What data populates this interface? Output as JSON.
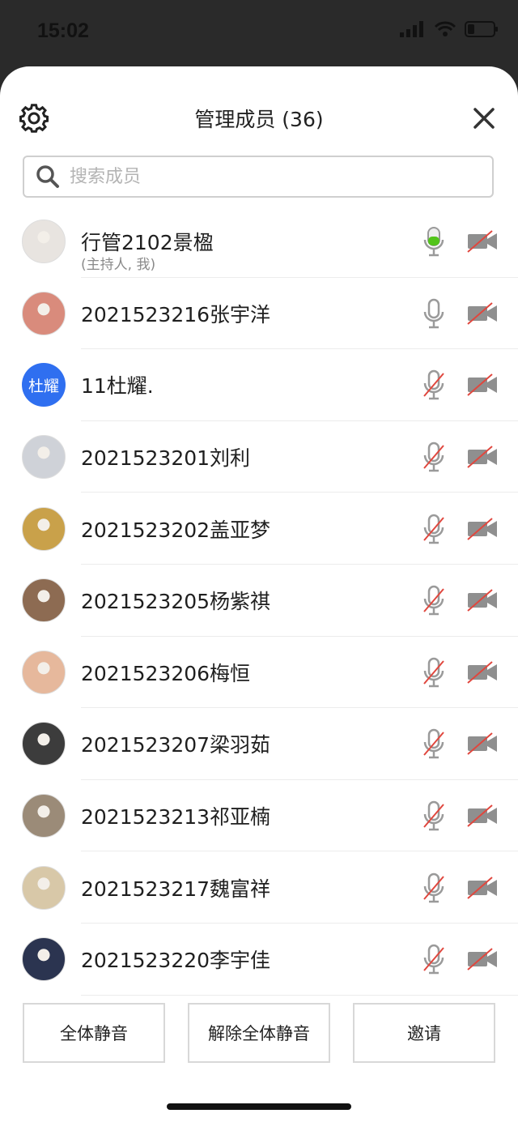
{
  "status_bar": {
    "time": "15:02"
  },
  "header": {
    "title": "管理成员 (36)"
  },
  "search": {
    "placeholder": "搜索成员"
  },
  "members": [
    {
      "name": "行管2102景楹",
      "sub": "(主持人, 我)",
      "mic": "active",
      "avatar": "photo-girl"
    },
    {
      "name": "2021523216张宇洋",
      "sub": "",
      "mic": "on",
      "avatar": "photo-cartoon"
    },
    {
      "name": "11杜耀.",
      "sub": "",
      "mic": "muted",
      "avatar": "text",
      "avatar_text": "杜耀"
    },
    {
      "name": "2021523201刘利",
      "sub": "",
      "mic": "muted",
      "avatar": "photo"
    },
    {
      "name": "2021523202盖亚梦",
      "sub": "",
      "mic": "muted",
      "avatar": "photo"
    },
    {
      "name": "2021523205杨紫祺",
      "sub": "",
      "mic": "muted",
      "avatar": "photo"
    },
    {
      "name": "2021523206梅恒",
      "sub": "",
      "mic": "muted",
      "avatar": "photo"
    },
    {
      "name": "2021523207梁羽茹",
      "sub": "",
      "mic": "muted",
      "avatar": "photo"
    },
    {
      "name": "2021523213祁亚楠",
      "sub": "",
      "mic": "muted",
      "avatar": "photo"
    },
    {
      "name": "2021523217魏富祥",
      "sub": "",
      "mic": "muted",
      "avatar": "photo"
    },
    {
      "name": "2021523220李宇佳",
      "sub": "",
      "mic": "muted",
      "avatar": "photo"
    }
  ],
  "footer": {
    "mute_all": "全体静音",
    "unmute_all": "解除全体静音",
    "invite": "邀请"
  },
  "colors": {
    "mic_active": "#52c41a",
    "slash": "#e0473e",
    "icon_gray": "#9a9a9a",
    "avatar_blue": "#2f6ff0"
  }
}
